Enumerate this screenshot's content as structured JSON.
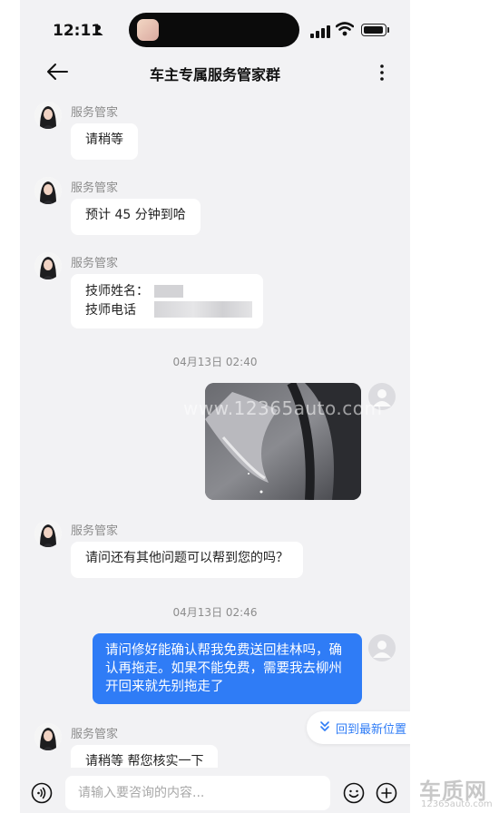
{
  "status_bar": {
    "time": "12:11"
  },
  "header": {
    "title": "车主专属服务管家群"
  },
  "messages": [
    {
      "sender": "服务管家",
      "text": "请稍等"
    },
    {
      "sender": "服务管家",
      "text": "预计 45 分钟到哈"
    },
    {
      "sender": "服务管家",
      "line1": "技师姓名：",
      "line2": "技师电话"
    },
    {
      "sender": "服务管家",
      "text": "请问还有其他问题可以帮到您的吗？"
    },
    {
      "sender": "服务管家",
      "text": "请稍等 帮您核实一下"
    }
  ],
  "time_dividers": [
    "04月13日 02:40",
    "04月13日 02:46"
  ],
  "user_message": {
    "text": "请问修好能确认帮我免费送回桂林吗，确认再拖走。如果不能免费，需要我去柳州开回来就先别拖走了"
  },
  "return_button": {
    "label": "回到最新位置"
  },
  "input": {
    "placeholder": "请输入要咨询的内容..."
  },
  "watermark": {
    "text": "www.12365auto.com"
  },
  "logo": {
    "main": "车质网",
    "sub": "12365auto.com"
  },
  "colors": {
    "accent": "#2f7cf6",
    "background": "#f2f2f4"
  },
  "icons": [
    "back-arrow-icon",
    "more-icon",
    "voice-icon",
    "emoji-icon",
    "plus-icon",
    "double-chevron-down-icon"
  ]
}
